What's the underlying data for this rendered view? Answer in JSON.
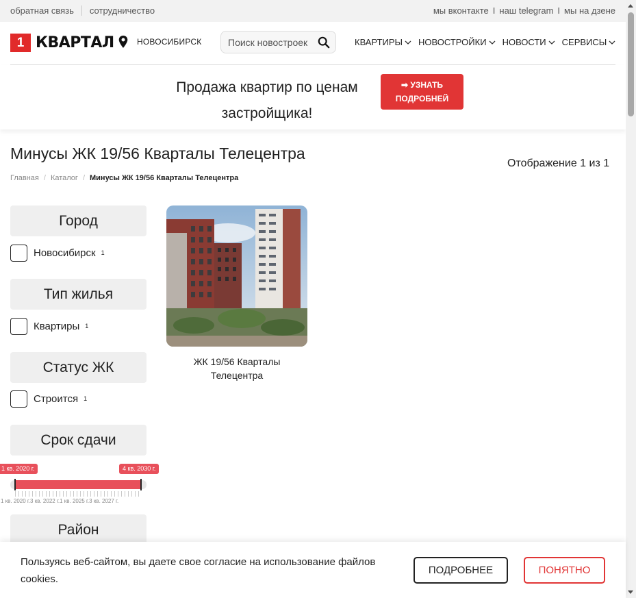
{
  "topbar": {
    "left_links": [
      "обратная связь",
      "сотрудничество"
    ],
    "right_links": [
      "мы вконтакте",
      "наш telegram",
      "мы на дзене"
    ],
    "separator": "I"
  },
  "header": {
    "logo_number": "1",
    "logo_word": "КВАРТАЛ",
    "city": "НОВОСИБИРСК",
    "search_placeholder": "Поиск новостроек",
    "nav": [
      "КВАРТИРЫ",
      "НОВОСТРОЙКИ",
      "НОВОСТИ",
      "СЕРВИСЫ"
    ],
    "brand_color": "#e12a2a"
  },
  "promo": {
    "text": "Продажа квартир по ценам застройщика!",
    "button": "➡ УЗНАТЬ ПОДРОБНЕЙ"
  },
  "page": {
    "title": "Минусы ЖК 19/56 Кварталы Телецентра",
    "breadcrumbs": [
      "Главная",
      "Каталог",
      "Минусы ЖК 19/56 Кварталы Телецентра"
    ],
    "result_count": "Отображение 1 из 1"
  },
  "filters": {
    "city": {
      "title": "Город",
      "option": "Новосибирск",
      "count": "1",
      "checked": false
    },
    "type": {
      "title": "Тип жилья",
      "option": "Квартиры",
      "count": "1",
      "checked": false
    },
    "status": {
      "title": "Статус ЖК",
      "option": "Строится",
      "count": "1",
      "checked": false
    },
    "deadline": {
      "title": "Срок сдачи",
      "min_label": "1 кв. 2020 г.",
      "max_label": "4 кв. 2030 г.",
      "selected_from_fraction": 0.0,
      "selected_to_fraction": 1.0,
      "scale_labels": "1 кв. 2020 г.3 кв. 2022 г.1 кв. 2025 г.3 кв. 2027 г."
    },
    "district": {
      "title": "Район"
    }
  },
  "listing": {
    "cards": [
      {
        "name": "ЖК 19/56 Кварталы Телецентра"
      }
    ]
  },
  "cookie": {
    "message": "Пользуясь веб-сайтом, вы даете свое согласие на использование файлов cookies.",
    "more_button": "ПОДРОБНЕЕ",
    "ok_button": "ПОНЯТНО"
  }
}
